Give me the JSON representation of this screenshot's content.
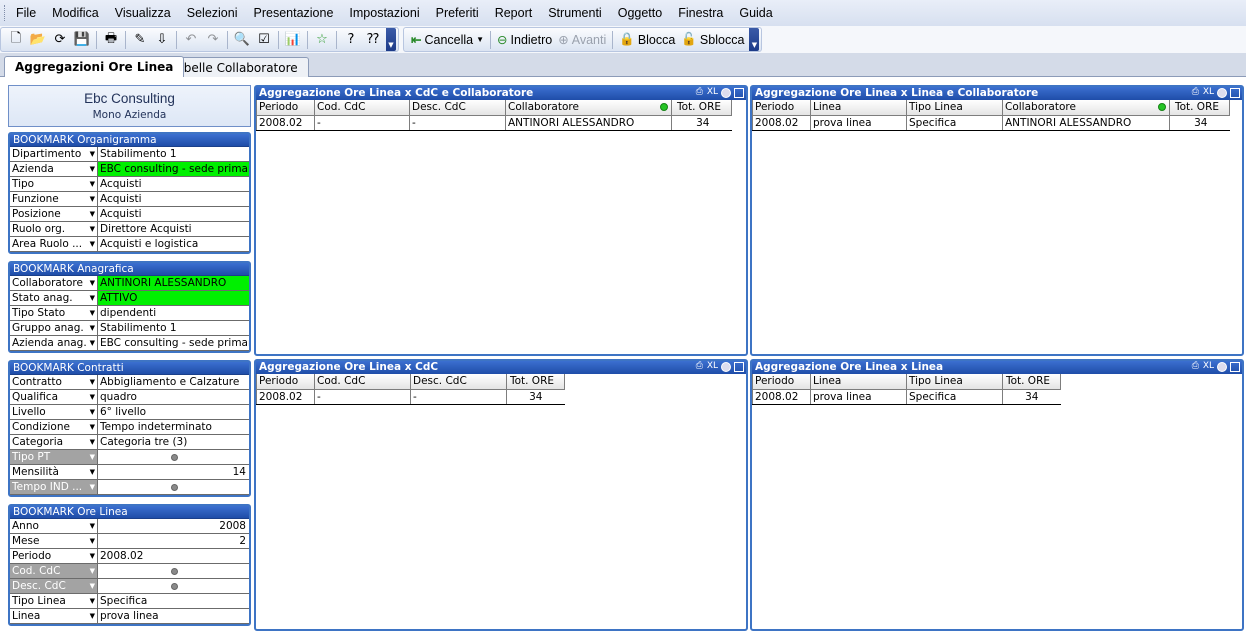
{
  "menu": [
    "File",
    "Modifica",
    "Visualizza",
    "Selezioni",
    "Presentazione",
    "Impostazioni",
    "Preferiti",
    "Report",
    "Strumenti",
    "Oggetto",
    "Finestra",
    "Guida"
  ],
  "toolbar": {
    "cancella": "Cancella",
    "indietro": "Indietro",
    "avanti": "Avanti",
    "blocca": "Blocca",
    "sblocca": "Sblocca"
  },
  "tabs": [
    "Aggregazioni Ore Linea",
    "Tabelle Collaboratore"
  ],
  "company": {
    "name": "Ebc Consulting",
    "subtitle": "Mono Azienda"
  },
  "bookmarks": [
    {
      "title": "BOOKMARK Organigramma",
      "rows": [
        {
          "label": "Dipartimento",
          "value": "Stabilimento 1",
          "style": ""
        },
        {
          "label": "Azienda",
          "value": "EBC consulting - sede primaria",
          "style": "green"
        },
        {
          "label": "Tipo",
          "value": "Acquisti",
          "style": ""
        },
        {
          "label": "Funzione",
          "value": "Acquisti",
          "style": ""
        },
        {
          "label": "Posizione",
          "value": "Acquisti",
          "style": ""
        },
        {
          "label": "Ruolo org.",
          "value": "Direttore Acquisti",
          "style": ""
        },
        {
          "label": "Area Ruolo ...",
          "value": "Acquisti e logistica",
          "style": ""
        }
      ]
    },
    {
      "title": "BOOKMARK Anagrafica",
      "rows": [
        {
          "label": "Collaboratore",
          "value": "ANTINORI ALESSANDRO",
          "style": "green"
        },
        {
          "label": "Stato anag.",
          "value": "ATTIVO",
          "style": "green"
        },
        {
          "label": "Tipo Stato",
          "value": "dipendenti",
          "style": ""
        },
        {
          "label": "Gruppo anag.",
          "value": "Stabilimento 1",
          "style": ""
        },
        {
          "label": "Azienda anag.",
          "value": "EBC consulting - sede primaria",
          "style": ""
        }
      ]
    },
    {
      "title": "BOOKMARK Contratti",
      "rows": [
        {
          "label": "Contratto",
          "value": "Abbigliamento e Calzature",
          "style": ""
        },
        {
          "label": "Qualifica",
          "value": "quadro",
          "style": ""
        },
        {
          "label": "Livello",
          "value": "6° livello",
          "style": ""
        },
        {
          "label": "Condizione",
          "value": "Tempo indeterminato",
          "style": ""
        },
        {
          "label": "Categoria",
          "value": "Categoria tre (3)",
          "style": ""
        },
        {
          "label": "Tipo PT",
          "value": "",
          "style": "null"
        },
        {
          "label": "Mensilità",
          "value": "14",
          "style": "num"
        },
        {
          "label": "Tempo IND ...",
          "value": "",
          "style": "null"
        }
      ]
    },
    {
      "title": "BOOKMARK Ore Linea",
      "rows": [
        {
          "label": "Anno",
          "value": "2008",
          "style": "num"
        },
        {
          "label": "Mese",
          "value": "2",
          "style": "num"
        },
        {
          "label": "Periodo",
          "value": "2008.02",
          "style": ""
        },
        {
          "label": "Cod. CdC",
          "value": "",
          "style": "null"
        },
        {
          "label": "Desc. CdC",
          "value": "",
          "style": "null"
        },
        {
          "label": "Tipo Linea",
          "value": "Specifica",
          "style": ""
        },
        {
          "label": "Linea",
          "value": "prova linea",
          "style": ""
        }
      ]
    }
  ],
  "panels": [
    {
      "title": "Aggregazione Ore Linea x CdC e Collaboratore",
      "columns": [
        "Periodo",
        "Cod. CdC",
        "Desc. CdC",
        "Collaboratore",
        "Tot. ORE"
      ],
      "rows": [
        [
          "2008.02",
          "-",
          "-",
          "ANTINORI ALESSANDRO",
          "34"
        ]
      ]
    },
    {
      "title": "Aggregazione Ore Linea x Linea e Collaboratore",
      "columns": [
        "Periodo",
        "Linea",
        "Tipo Linea",
        "Collaboratore",
        "Tot. ORE"
      ],
      "rows": [
        [
          "2008.02",
          "prova linea",
          "Specifica",
          "ANTINORI ALESSANDRO",
          "34"
        ]
      ]
    },
    {
      "title": "Aggregazione Ore Linea x CdC",
      "columns": [
        "Periodo",
        "Cod. CdC",
        "Desc. CdC",
        "Tot. ORE"
      ],
      "rows": [
        [
          "2008.02",
          "-",
          "-",
          "34"
        ]
      ]
    },
    {
      "title": "Aggregazione Ore Linea x Linea",
      "columns": [
        "Periodo",
        "Linea",
        "Tipo Linea",
        "Tot. ORE"
      ],
      "rows": [
        [
          "2008.02",
          "prova linea",
          "Specifica",
          "34"
        ]
      ]
    }
  ],
  "panel_icons": [
    "print-icon",
    "XL",
    "refresh-icon",
    "maximize-icon"
  ],
  "colors": {
    "header_blue": "#1f4da8",
    "selected_green": "#00f000",
    "excluded_gray": "#a3a3a3"
  }
}
